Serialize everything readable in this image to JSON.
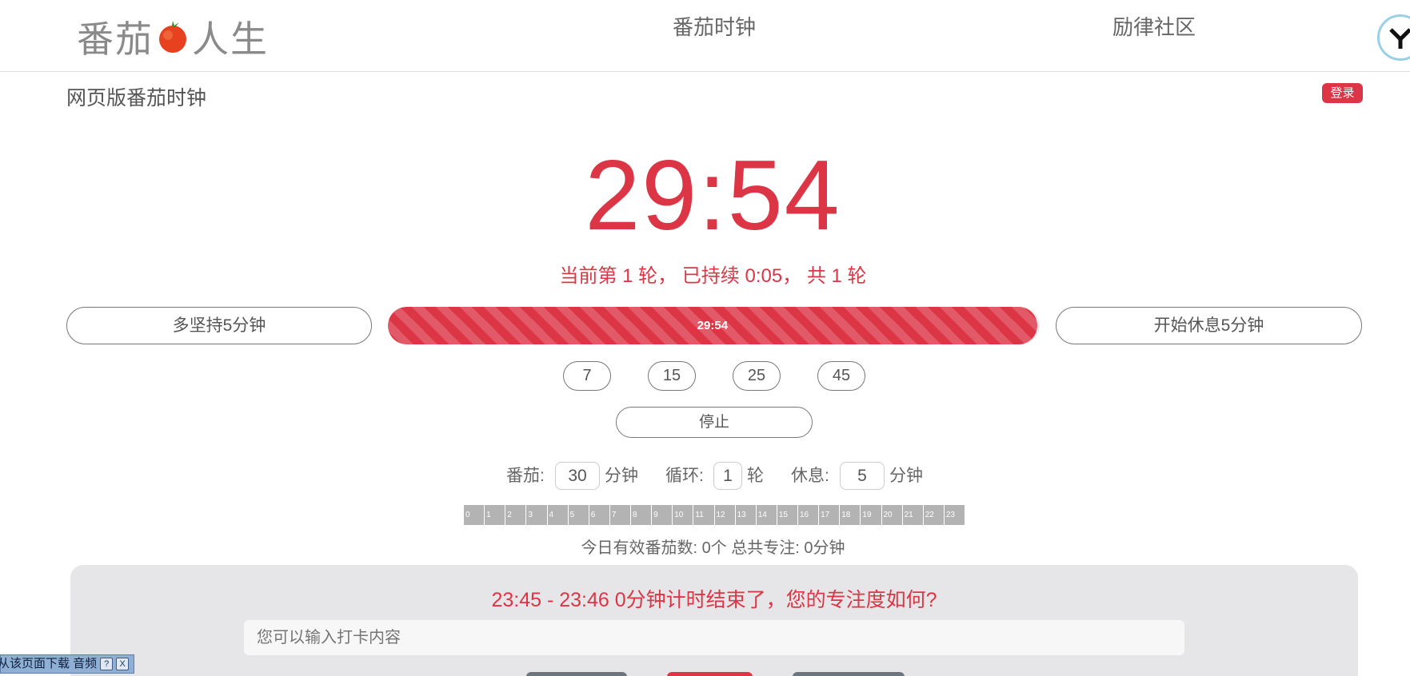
{
  "header": {
    "logo_left": "番茄",
    "logo_right": "人生",
    "nav": [
      "番茄时钟",
      "励律社区"
    ]
  },
  "page": {
    "subtitle": "网页版番茄时钟",
    "login_label": "登录"
  },
  "timer": {
    "display": "29:54",
    "round_info": "当前第 1 轮， 已持续 0:05， 共 1 轮",
    "progress_label": "29:54",
    "progress_fraction": 0.996
  },
  "controls": {
    "extend_label": "多坚持5分钟",
    "rest_label": "开始休息5分钟",
    "presets": [
      "7",
      "15",
      "25",
      "45"
    ],
    "stop_label": "停止"
  },
  "settings": {
    "tomato_label": "番茄:",
    "tomato_value": "30",
    "tomato_unit": "分钟",
    "cycle_label": "循环:",
    "cycle_value": "1",
    "cycle_unit": "轮",
    "rest_label": "休息:",
    "rest_value": "5",
    "rest_unit": "分钟"
  },
  "hours": [
    "0",
    "1",
    "2",
    "3",
    "4",
    "5",
    "6",
    "7",
    "8",
    "9",
    "10",
    "11",
    "12",
    "13",
    "14",
    "15",
    "16",
    "17",
    "18",
    "19",
    "20",
    "21",
    "22",
    "23"
  ],
  "stats": {
    "text": "今日有效番茄数: 0个   总共专注: 0分钟"
  },
  "feedback": {
    "title": "23:45 - 23:46 0分钟计时结束了，您的专注度如何?",
    "input_placeholder": "您可以输入打卡内容"
  },
  "download_bar": {
    "label": "从该页面下载 音频",
    "help_icon": "?",
    "close_icon": "X"
  },
  "colors": {
    "accent": "#dc3545",
    "panel": "#e6e6e8",
    "hour_bar": "#b3b3b3"
  }
}
